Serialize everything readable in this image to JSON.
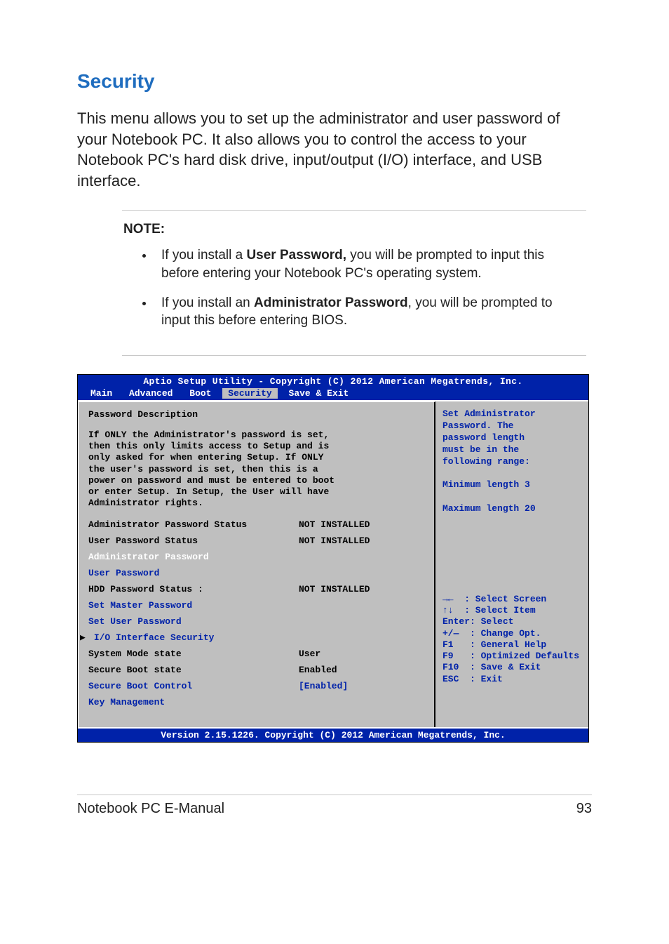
{
  "heading": "Security",
  "intro": "This menu allows you to set up the administrator and user password of your Notebook PC. It also allows you to control the access to your Notebook PC's hard disk drive, input/output (I/O) interface, and USB interface.",
  "note": {
    "label": "NOTE:",
    "items": [
      {
        "pre": "If you install a ",
        "strong": "User Password,",
        "post": " you will be prompted to input this before entering your Notebook PC's operating system."
      },
      {
        "pre": "If you install an ",
        "strong": "Administrator Password",
        "post": ", you will be prompted to input this before entering BIOS."
      }
    ]
  },
  "bios": {
    "header": "Aptio Setup Utility - Copyright (C) 2012 American Megatrends, Inc.",
    "tabs": [
      "Main",
      "Advanced",
      "Boot",
      "Security",
      "Save & Exit"
    ],
    "active_tab": "Security",
    "left": {
      "desc_title": "Password Description",
      "desc_body": "If ONLY the Administrator's password is set,\nthen this only limits access to Setup and is\nonly asked for when entering Setup. If ONLY\nthe user's password is set, then this is a\npower on password and must be entered to boot\nor enter Setup. In Setup, the User will have\nAdministrator rights.",
      "rows": [
        {
          "k": "Administrator Password Status",
          "v": "NOT INSTALLED",
          "style": "black"
        },
        {
          "k": "User Password Status",
          "v": "NOT INSTALLED",
          "style": "black"
        },
        {
          "k": "Administrator Password",
          "v": "",
          "style": "selected"
        },
        {
          "k": "User Password",
          "v": "",
          "style": "blue"
        },
        {
          "k": "HDD Password Status :",
          "v": "NOT INSTALLED",
          "style": "black"
        },
        {
          "k": "Set Master Password",
          "v": "",
          "style": "blue"
        },
        {
          "k": "Set User Password",
          "v": "",
          "style": "blue"
        },
        {
          "k": "I/O Interface Security",
          "v": "",
          "style": "blue",
          "submenu": true
        },
        {
          "k": "System Mode state",
          "v": "User",
          "style": "black"
        },
        {
          "k": "Secure Boot state",
          "v": "Enabled",
          "style": "black"
        },
        {
          "k": "Secure Boot Control",
          "v": "[Enabled]",
          "style": "blue"
        },
        {
          "k": "Key Management",
          "v": "",
          "style": "blue"
        }
      ]
    },
    "right": {
      "help_lines": [
        "Set Administrator",
        "Password. The",
        "password length",
        "must be in the",
        "following range:",
        "",
        "Minimum length 3",
        "",
        "Maximum length 20"
      ],
      "nav": "→←  : Select Screen\n↑↓  : Select Item\nEnter: Select\n+/—  : Change Opt.\nF1   : General Help\nF9   : Optimized Defaults\nF10  : Save & Exit\nESC  : Exit"
    },
    "footer": "Version 2.15.1226. Copyright (C) 2012 American Megatrends, Inc."
  },
  "footer": {
    "left": "Notebook PC E-Manual",
    "right": "93"
  }
}
